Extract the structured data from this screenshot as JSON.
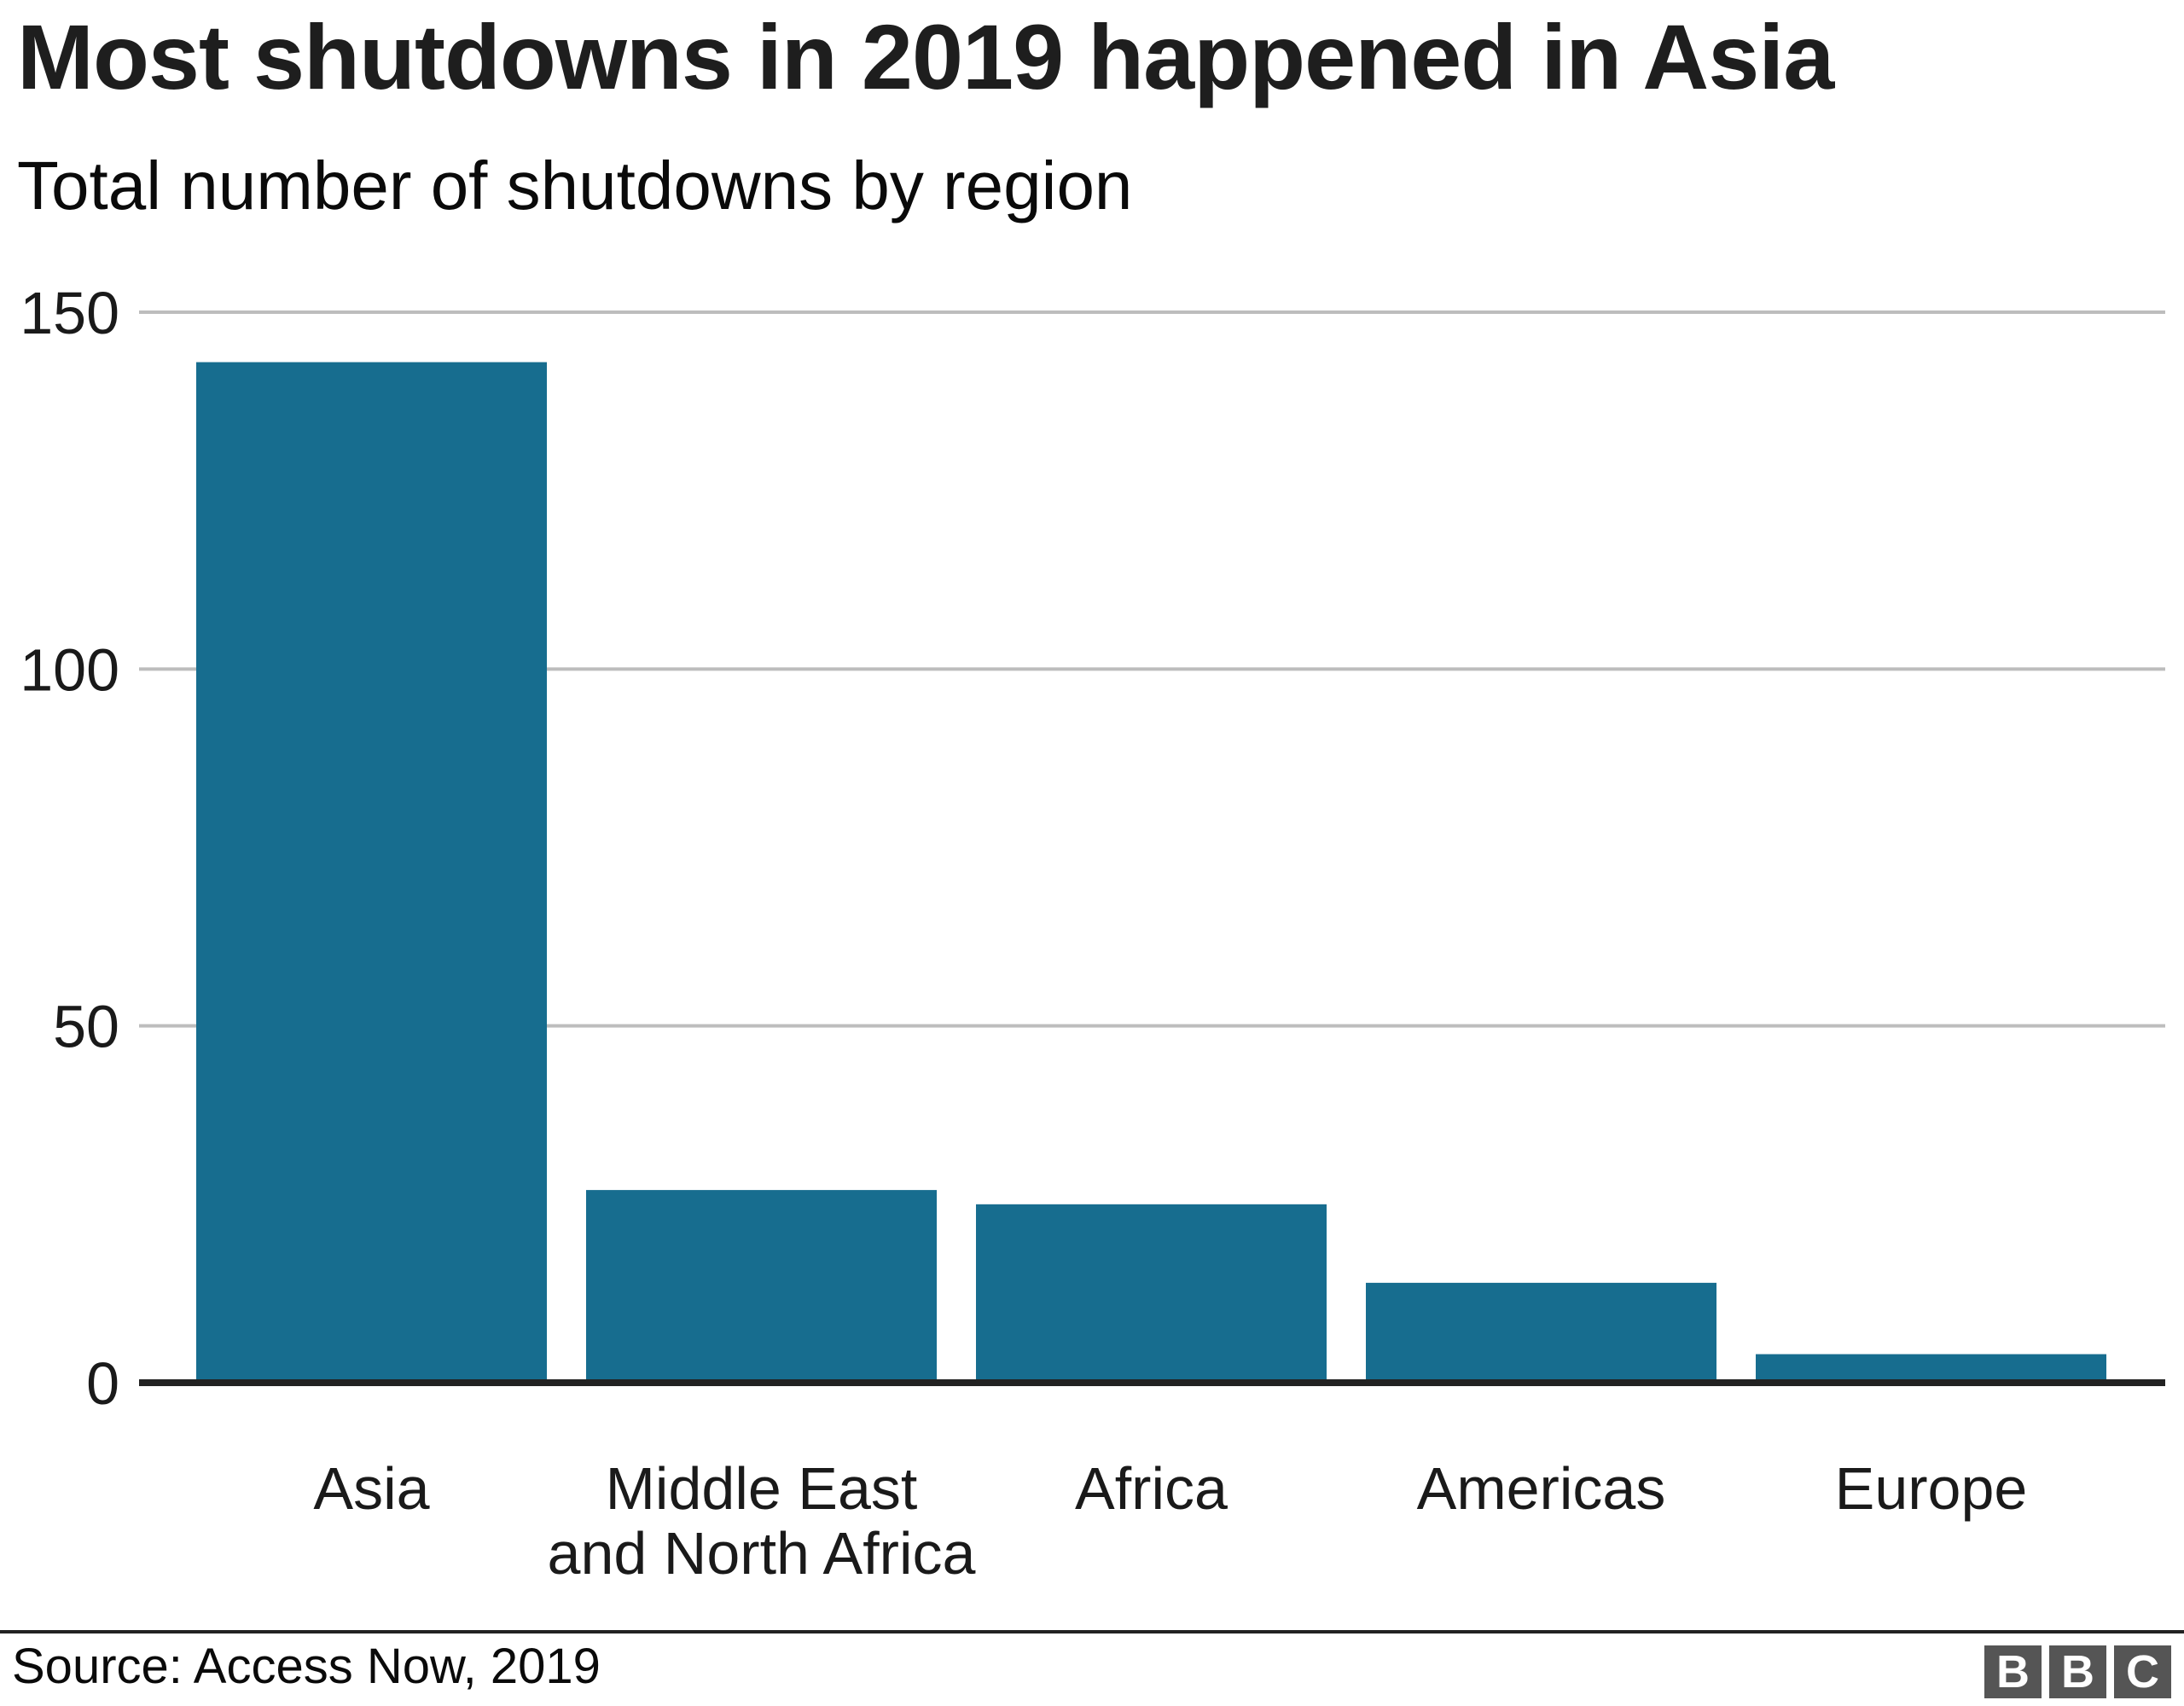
{
  "chart_data": {
    "type": "bar",
    "title": "Most shutdowns in 2019 happened in Asia",
    "subtitle": "Total number of shutdowns by region",
    "categories": [
      [
        "Asia"
      ],
      [
        "Middle East",
        "and North Africa"
      ],
      [
        "Africa"
      ],
      [
        "Americas"
      ],
      [
        "Europe"
      ]
    ],
    "values": [
      143,
      27,
      25,
      14,
      4
    ],
    "xlabel": "",
    "ylabel": "",
    "ylim": [
      0,
      150
    ],
    "yticks": [
      0,
      50,
      100,
      150
    ],
    "grid": true,
    "legend": "none",
    "bar_color": "#176d8f",
    "grid_color": "#bdbdbd",
    "baseline_color": "#222222"
  },
  "footer": {
    "source": "Source: Access Now, 2019",
    "logo_letters": [
      "B",
      "B",
      "C"
    ]
  }
}
